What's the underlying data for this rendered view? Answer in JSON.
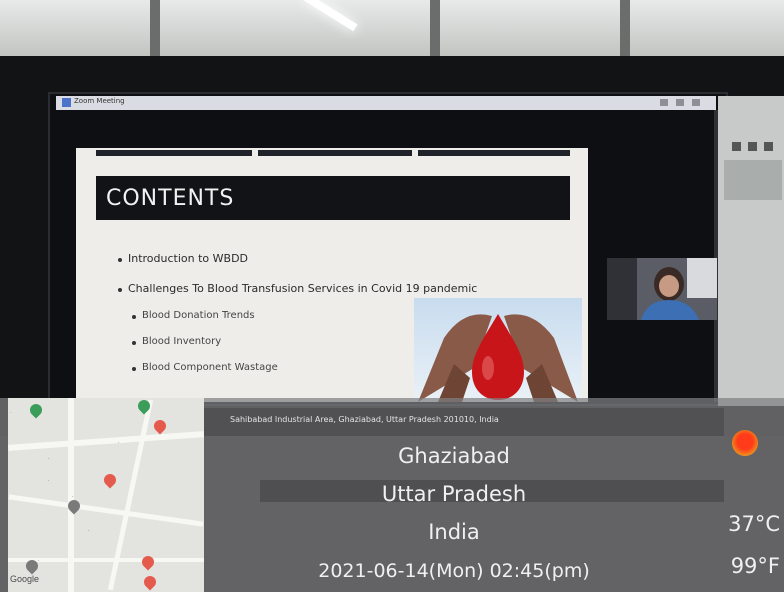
{
  "monitor": {
    "window_title": "Zoom Meeting",
    "slide": {
      "heading": "CONTENTS",
      "bullets": [
        "Introduction to WBDD",
        "Challenges To Blood Transfusion Services in Covid 19 pandemic"
      ],
      "sub_bullets": [
        "Blood Donation Trends",
        "Blood Inventory",
        "Blood Component Wastage"
      ]
    }
  },
  "overlay": {
    "address": "Sahibabad Industrial Area, Ghaziabad, Uttar Pradesh 201010, India",
    "city": "Ghaziabad",
    "state": "Uttar Pradesh",
    "country": "India",
    "datetime": "2021-06-14(Mon)  02:45(pm)",
    "temp_c": "37°C",
    "temp_f": "99°F",
    "weather_icon": "sun-icon",
    "map_brand": "Google"
  },
  "colors": {
    "overlay_gray": "#808082",
    "slide_heading_bg": "#111317",
    "blood_red": "#c8151a",
    "sun_red": "#ff3b1a"
  }
}
